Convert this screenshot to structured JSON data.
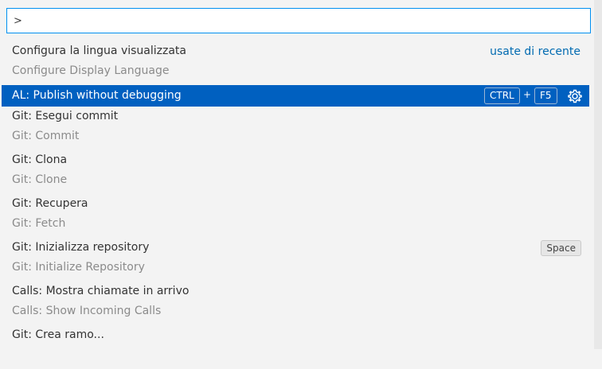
{
  "input": {
    "value": ">"
  },
  "items": [
    {
      "label": "Configura la lingua visualizzata",
      "detail": "Configure Display Language",
      "badge": "usate di recente"
    },
    {
      "label": "AL: Publish without debugging",
      "keys": [
        "CTRL",
        "F5"
      ],
      "key_separator": "+"
    },
    {
      "label": "Git: Esegui commit",
      "detail": "Git: Commit"
    },
    {
      "label": "Git: Clona",
      "detail": "Git: Clone"
    },
    {
      "label": "Git: Recupera",
      "detail": "Git: Fetch"
    },
    {
      "label": "Git: Inizializza repository",
      "detail": "Git: Initialize Repository",
      "key": "Space"
    },
    {
      "label": "Calls: Mostra chiamate in arrivo",
      "detail": "Calls: Show Incoming Calls"
    },
    {
      "label": "Git: Crea ramo..."
    }
  ],
  "colors": {
    "selection": "#0060c0",
    "focus_border": "#0090f1",
    "link": "#006ab1"
  },
  "icons": {
    "settings": "gear-icon"
  }
}
